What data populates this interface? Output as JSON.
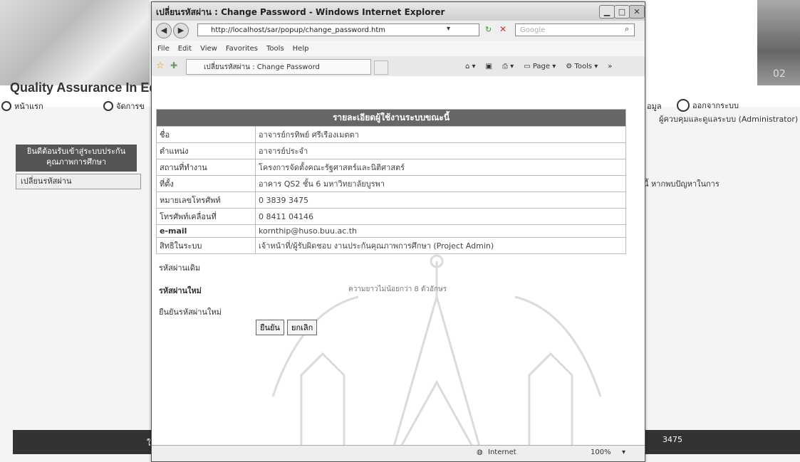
{
  "background_page": {
    "title": "Quality Assurance In Edu",
    "badge": "02",
    "nav": {
      "home": "หน้าแรก",
      "manage": "จัดการข",
      "data": "อมูล",
      "logout": "ออกจากระบบ"
    },
    "admin_text": "ผู้ควบคุมและดูแลระบบ (Administrator)",
    "left_banner": "ยินดีต้อนรับเข้าสู่ระบบประกันคุณภาพการศึกษา",
    "left_item": "เปลี่ยนรหัสผ่าน",
    "notice_text": "นี้ หากพบปัญหาในการ",
    "footer_left": "ใ",
    "footer_right": "3475"
  },
  "browser": {
    "window_title": "เปลี่ยนรหัสผ่าน : Change Password - Windows Internet Explorer",
    "address": "http://localhost/sar/popup/change_password.htm",
    "search_placeholder": "Google",
    "menu": [
      "File",
      "Edit",
      "View",
      "Favorites",
      "Tools",
      "Help"
    ],
    "tab_label": "เปลี่ยนรหัสผ่าน : Change Password",
    "cmd_page": "Page",
    "cmd_tools": "Tools",
    "status_zone": "Internet",
    "zoom": "100%"
  },
  "info": {
    "header": "รายละเอียดผู้ใช้งานระบบขณะนี้",
    "rows": [
      {
        "label": "ชื่อ",
        "value": "อาจารย์กรทิพย์  ศรีเรืองเมตตา"
      },
      {
        "label": "ตำแหน่ง",
        "value": "อาจารย์ประจำ"
      },
      {
        "label": "สถานที่ทำงาน",
        "value": "โครงการจัดตั้งคณะรัฐศาสตร์และนิติศาสตร์"
      },
      {
        "label": "ที่ตั้ง",
        "value": "อาคาร QS2 ชั้น 6 มหาวิทยาลัยบูรพา"
      },
      {
        "label": "หมายเลขโทรศัพท์",
        "value": "0 3839 3475"
      },
      {
        "label": "โทรศัพท์เคลื่อนที่",
        "value": "0 8411 04146"
      },
      {
        "label": "e-mail",
        "value": "kornthip@huso.buu.ac.th"
      },
      {
        "label": "สิทธิในระบบ",
        "value": "เจ้าหน้าที่/ผู้รับผิดชอบ งานประกันคุณภาพการศึกษา (Project Admin)"
      }
    ]
  },
  "form": {
    "old_password_label": "รหัสผ่านเดิม",
    "new_password_label": "รหัสผ่านใหม่",
    "new_password_hint": "ความยาวไม่น้อยกว่า 8 ตัวอักษร",
    "confirm_password_label": "ยืนยันรหัสผ่านใหม่",
    "confirm_button": "ยืนยัน",
    "cancel_button": "ยกเลิก"
  }
}
